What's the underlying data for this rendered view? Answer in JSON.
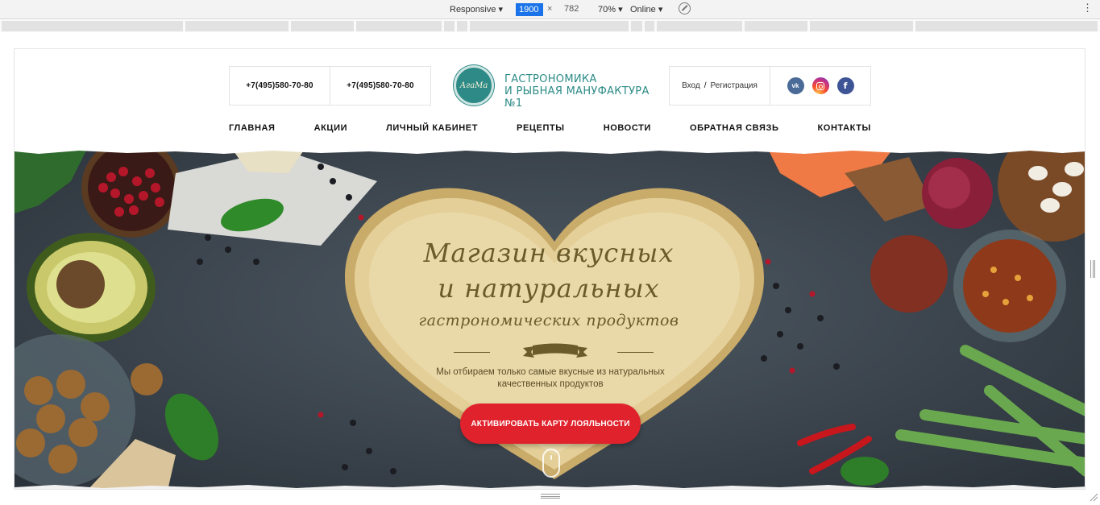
{
  "devtools": {
    "device": "Responsive",
    "width": "1900",
    "times": "×",
    "height": "782",
    "zoom": "70%",
    "network": "Online",
    "menu": "⋮"
  },
  "header": {
    "phone1": "+7(495)580-70-80",
    "phone2": "+7(495)580-70-80",
    "logo_mark": "АгаМа",
    "logo_line1": "Гастрономика",
    "logo_line2": "и рыбная мануфактура №1",
    "auth": {
      "login": "Вход",
      "separator": "/",
      "register": "Регистрация"
    },
    "social": [
      {
        "name": "vk",
        "icon": "vk-icon",
        "glyph": "vk"
      },
      {
        "name": "instagram",
        "icon": "instagram-icon"
      },
      {
        "name": "facebook",
        "icon": "facebook-icon",
        "glyph": "f"
      }
    ]
  },
  "nav": {
    "items": [
      {
        "label": "ГЛАВНАЯ"
      },
      {
        "label": "АКЦИИ"
      },
      {
        "label": "ЛИЧНЫЙ КАБИНЕТ"
      },
      {
        "label": "РЕЦЕПТЫ"
      },
      {
        "label": "НОВОСТИ"
      },
      {
        "label": "ОБРАТНАЯ СВЯЗЬ"
      },
      {
        "label": "КОНТАКТЫ"
      }
    ]
  },
  "hero": {
    "title_line1": "Магазин вкусных",
    "title_line2": "и натуральных",
    "title_line3": "гастрономических продуктов",
    "subtitle_line1": "Мы отбираем только самые вкусные из натуральных",
    "subtitle_line2": "качественных продуктов",
    "cta": "АКТИВИРОВАТЬ КАРТУ ЛОЯЛЬНОСТИ"
  },
  "colors": {
    "accent_red": "#e0222c",
    "logo_teal": "#2e8a86",
    "board_wood": "#e2cc93",
    "slate": "#3b444d"
  }
}
